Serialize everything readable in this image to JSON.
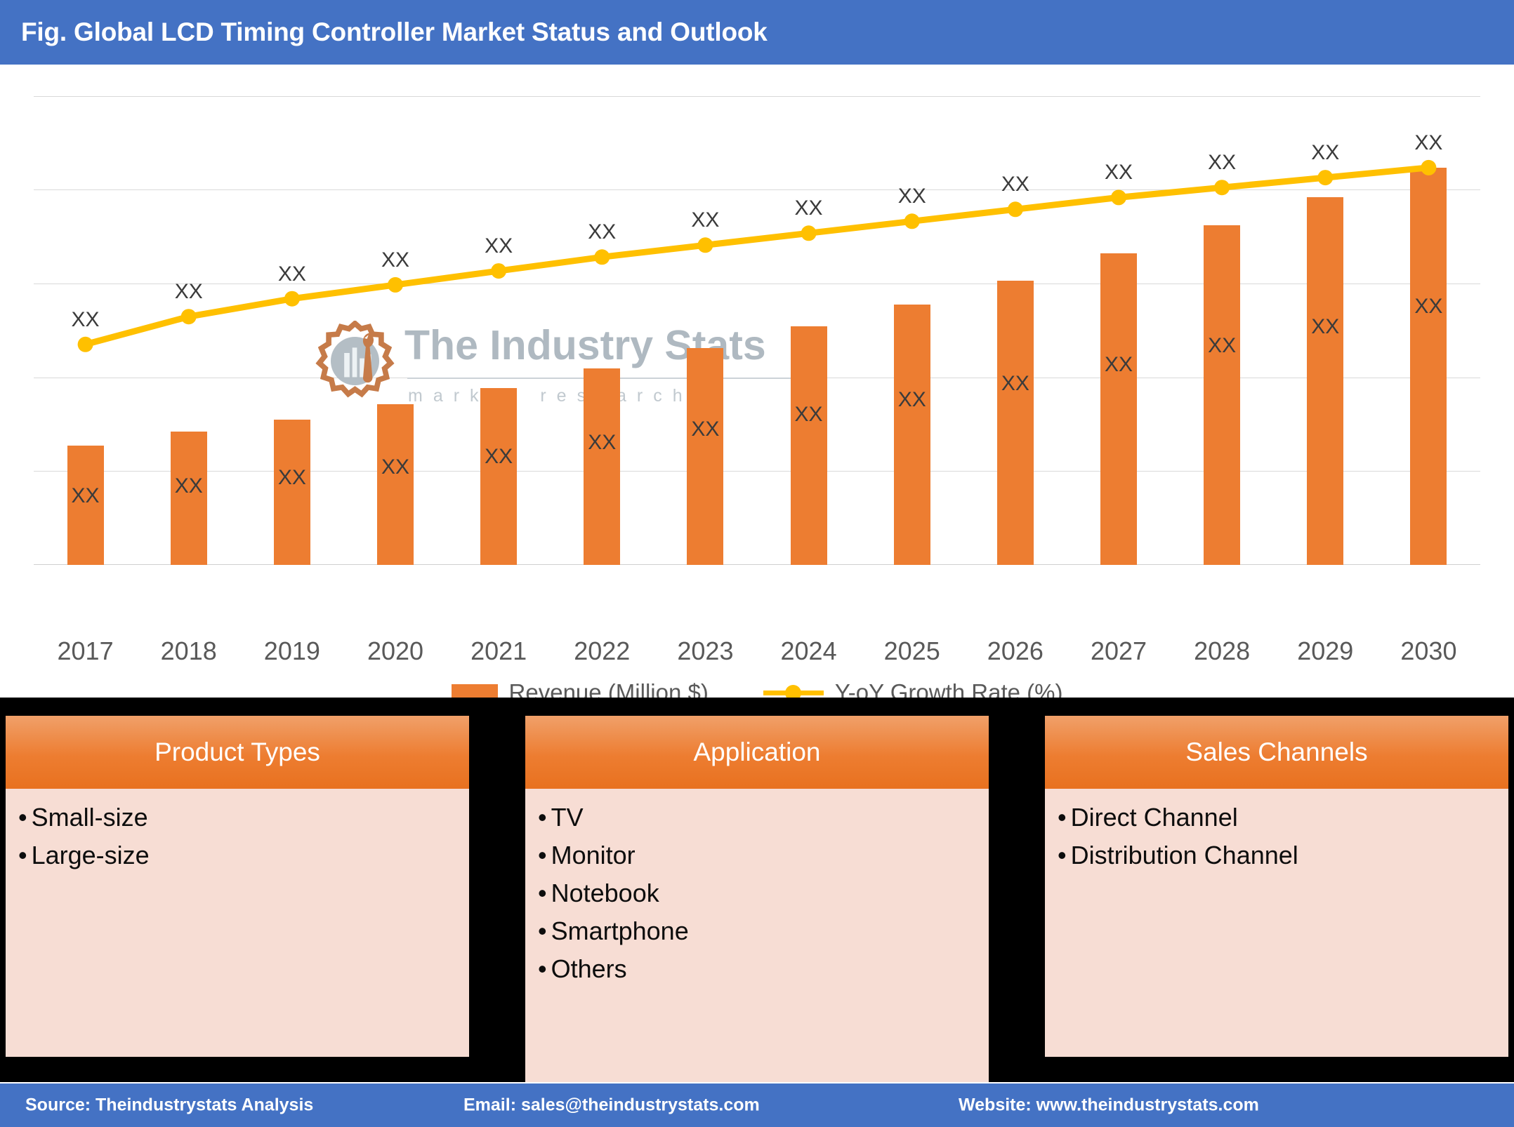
{
  "header": {
    "title": "Fig. Global LCD Timing Controller Market Status and Outlook",
    "background_color": "#4472C4",
    "text_color": "#FFFFFF"
  },
  "watermark": {
    "title": "The Industry Stats",
    "subtitle": "m a r k e t   r e s e a r c h",
    "logo_icon": "gear-factory-logo-icon"
  },
  "chart_data": {
    "type": "bar",
    "title": "Fig. Global LCD Timing Controller Market Status and Outlook",
    "xlabel": "",
    "ylabel": "",
    "grid": true,
    "legend_position": "bottom",
    "categories": [
      "2017",
      "2018",
      "2019",
      "2020",
      "2021",
      "2022",
      "2023",
      "2024",
      "2025",
      "2026",
      "2027",
      "2028",
      "2029",
      "2030"
    ],
    "series": [
      {
        "name": "Revenue (Million $)",
        "type": "bar",
        "color": "#ED7D31",
        "axis": "left",
        "values": [
          30.0,
          33.5,
          36.5,
          40.5,
          44.5,
          49.5,
          54.5,
          60.0,
          65.5,
          71.5,
          78.5,
          85.5,
          92.5,
          100.0
        ],
        "data_labels": [
          "XX",
          "XX",
          "XX",
          "XX",
          "XX",
          "XX",
          "XX",
          "XX",
          "XX",
          "XX",
          "XX",
          "XX",
          "XX",
          "XX"
        ]
      },
      {
        "name": "Y-oY Growth Rate (%)",
        "type": "line",
        "color": "#FFC000",
        "axis": "right",
        "values": [
          55.5,
          62.5,
          67.0,
          70.5,
          74.0,
          77.5,
          80.5,
          83.5,
          86.5,
          89.5,
          92.5,
          95.0,
          97.5,
          100.0
        ],
        "data_labels": [
          "XX",
          "XX",
          "XX",
          "XX",
          "XX",
          "XX",
          "XX",
          "XX",
          "XX",
          "XX",
          "XX",
          "XX",
          "XX",
          "XX"
        ]
      }
    ],
    "ylim": [
      0,
      118
    ],
    "gridline_values": [
      0,
      23.6,
      47.2,
      70.8,
      94.4,
      118
    ]
  },
  "legend": {
    "items": [
      {
        "label": "Revenue (Million $)",
        "marker": "bar-swatch",
        "color": "#ED7D31"
      },
      {
        "label": "Y-oY Growth Rate (%)",
        "marker": "line-marker",
        "color": "#FFC000"
      }
    ]
  },
  "category_boxes": [
    {
      "title": "Product Types",
      "items": [
        "Small-size",
        "Large-size"
      ],
      "header_color": "#ED7D31",
      "body_color": "#F7DDD4"
    },
    {
      "title": "Application",
      "items": [
        "TV",
        "Monitor",
        "Notebook",
        "Smartphone",
        "Others"
      ],
      "header_color": "#ED7D31",
      "body_color": "#F7DDD4"
    },
    {
      "title": "Sales Channels",
      "items": [
        "Direct Channel",
        "Distribution Channel"
      ],
      "header_color": "#ED7D31",
      "body_color": "#F7DDD4"
    }
  ],
  "footer": {
    "source": "Source: Theindustrystats Analysis",
    "email": "Email: sales@theindustrystats.com",
    "website": "Website: www.theindustrystats.com",
    "background_color": "#4472C4"
  },
  "bullet": "•"
}
